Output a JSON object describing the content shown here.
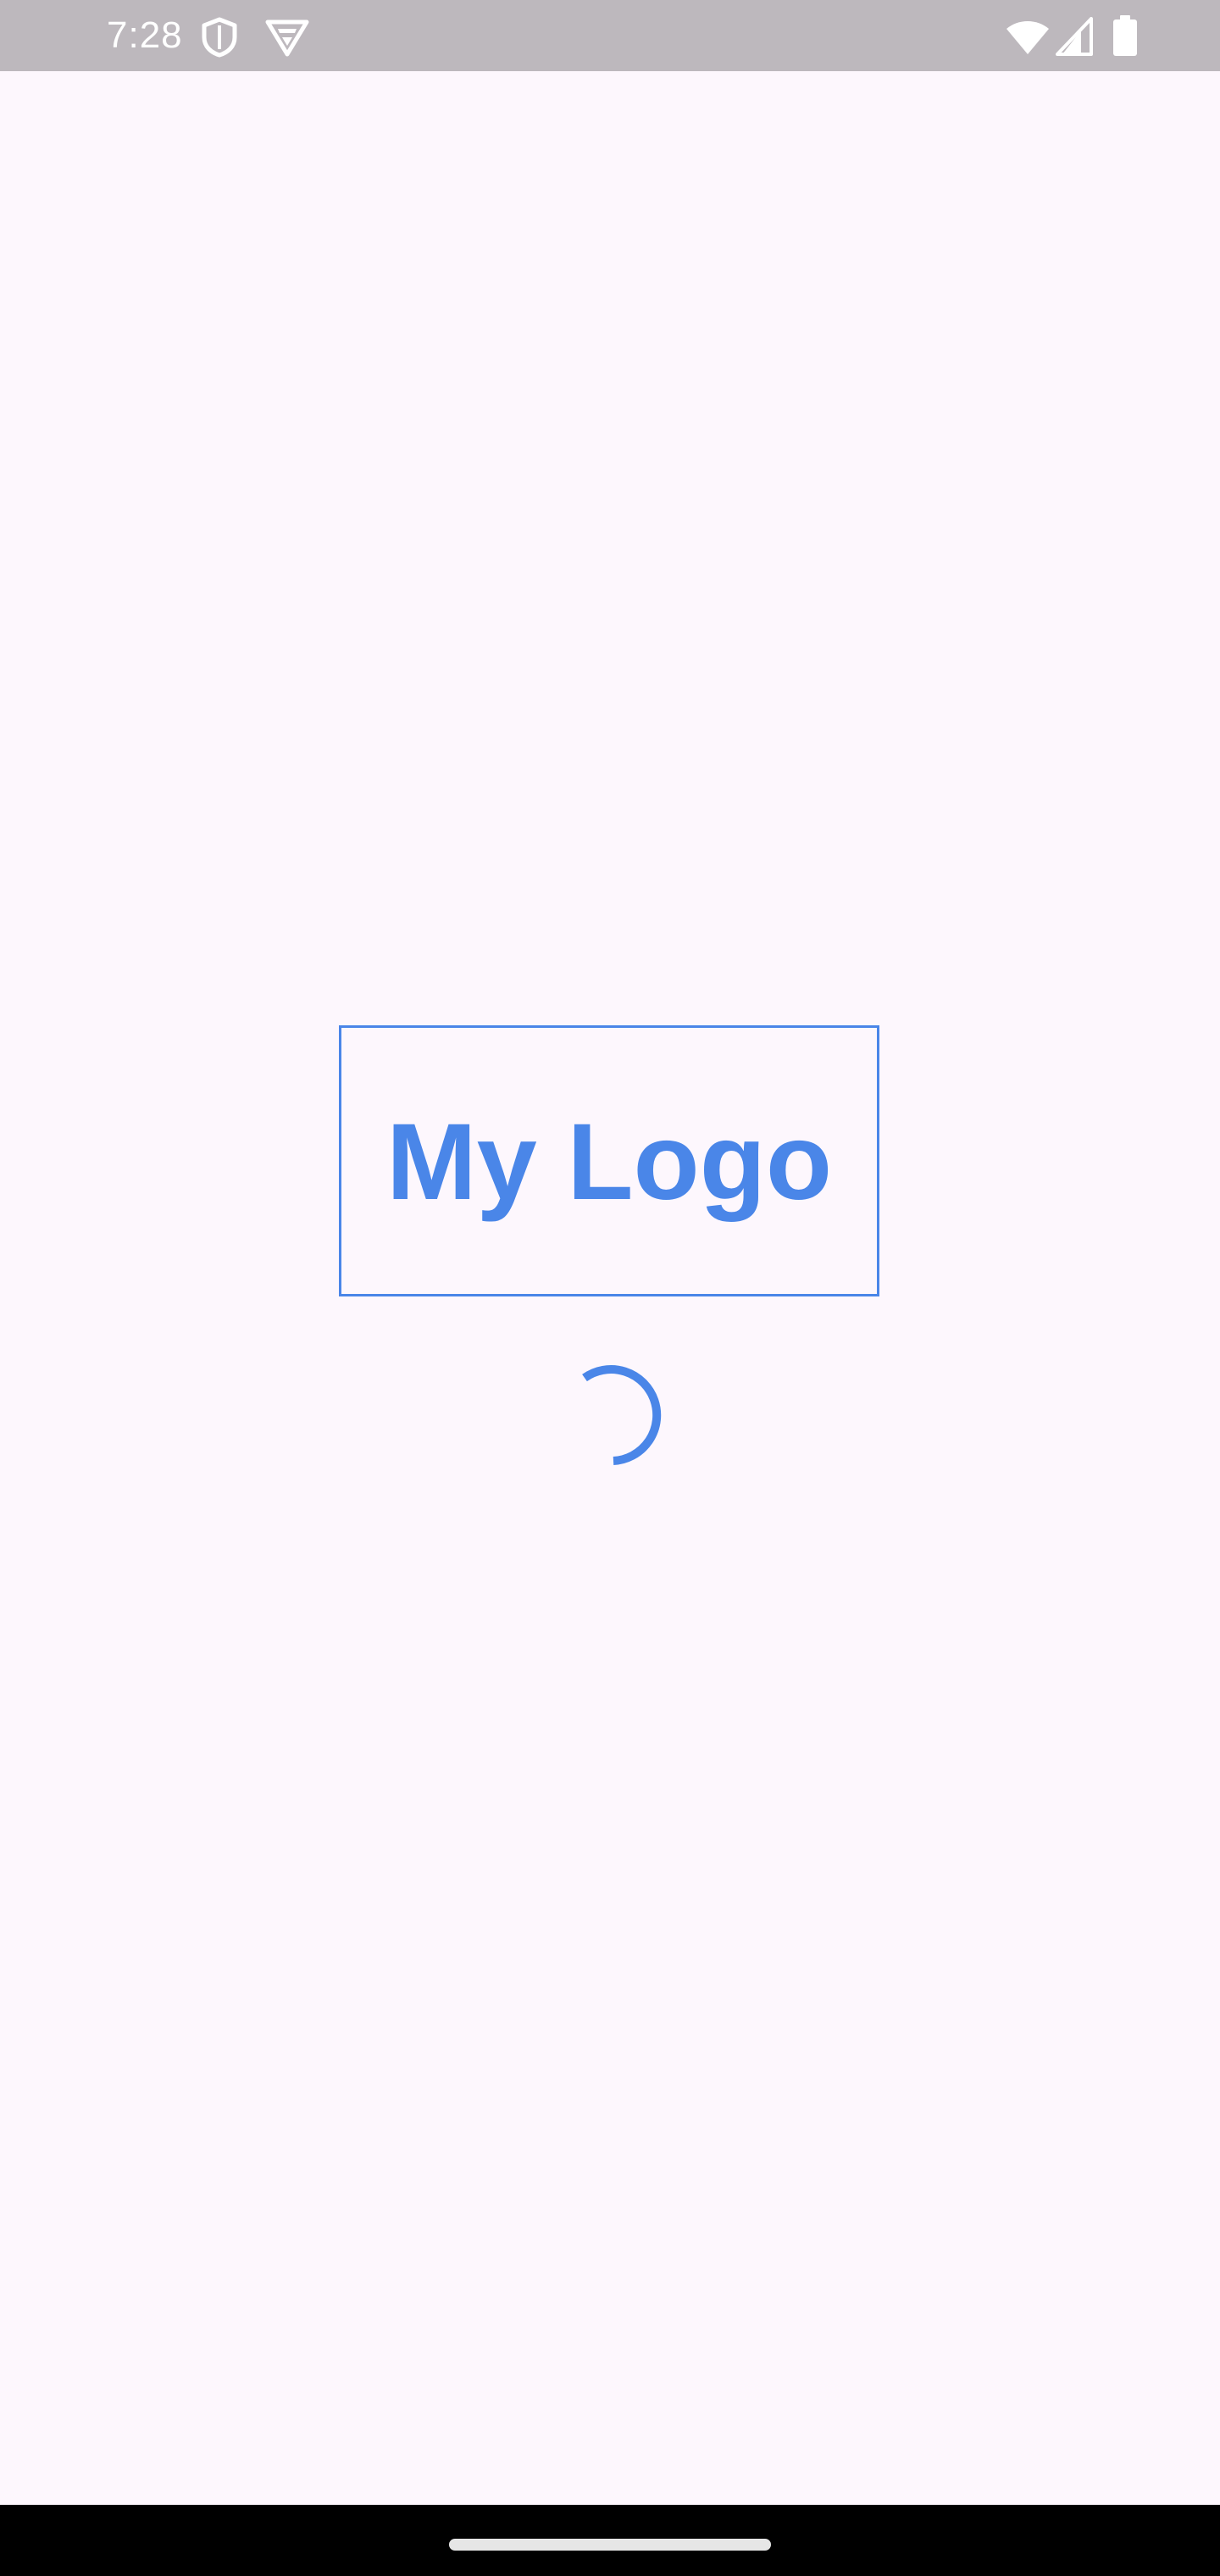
{
  "status_bar": {
    "time": "7:28",
    "background_color": "#BDB8BD",
    "left_icons": [
      "shield-icon",
      "vpn-icon"
    ],
    "right_icons": [
      "wifi-icon",
      "signal-icon",
      "battery-icon"
    ]
  },
  "splash": {
    "logo_text": "My Logo",
    "accent_color": "#4A86E8",
    "background_color": "#FDF7FD",
    "loading": true
  },
  "nav_bar": {
    "background_color": "#000000",
    "gesture": "home-handle"
  }
}
